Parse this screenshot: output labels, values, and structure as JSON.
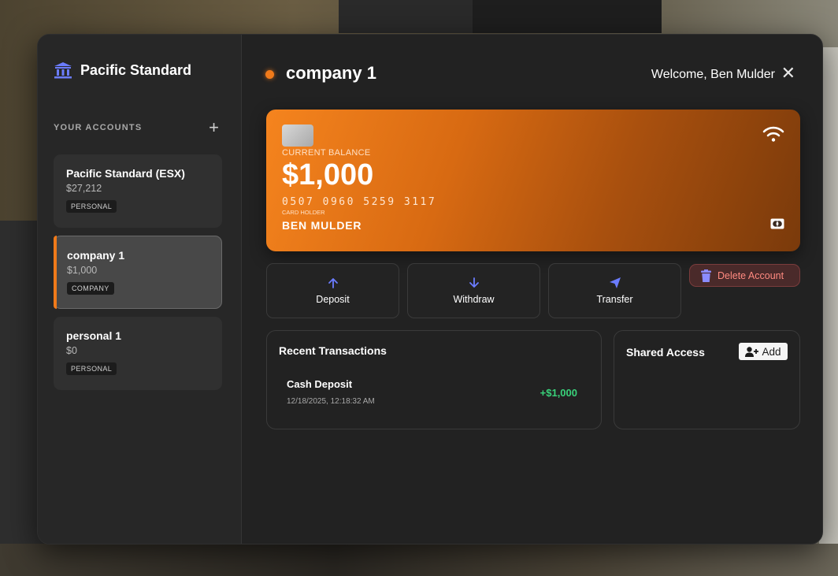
{
  "brand": {
    "name": "Pacific Standard",
    "icon": "bank-icon"
  },
  "sidebar": {
    "header_label": "YOUR ACCOUNTS",
    "add_label": "+",
    "accounts": [
      {
        "name": "Pacific Standard (ESX)",
        "balance": "$27,212",
        "tag": "PERSONAL",
        "active": false
      },
      {
        "name": "company 1",
        "balance": "$1,000",
        "tag": "COMPANY",
        "active": true
      },
      {
        "name": "personal 1",
        "balance": "$0",
        "tag": "PERSONAL",
        "active": false
      }
    ]
  },
  "header": {
    "account_title": "company 1",
    "welcome": "Welcome, Ben Mulder",
    "close_label": "✕",
    "status_color": "#f07a1a"
  },
  "card": {
    "balance_label": "CURRENT BALANCE",
    "balance": "$1,000",
    "number": "0507 0960 5259 3117",
    "holder_label": "CARD HOLDER",
    "holder": "BEN MULDER",
    "gradient_start": "#f5841e",
    "gradient_end": "#7a3a0b"
  },
  "actions": {
    "deposit": "Deposit",
    "withdraw": "Withdraw",
    "transfer": "Transfer",
    "delete": "Delete Account"
  },
  "transactions": {
    "title": "Recent Transactions",
    "items": [
      {
        "name": "Cash Deposit",
        "date": "12/18/2025, 12:18:32 AM",
        "amount": "+$1,000"
      }
    ]
  },
  "shared": {
    "title": "Shared Access",
    "add_label": "Add"
  }
}
